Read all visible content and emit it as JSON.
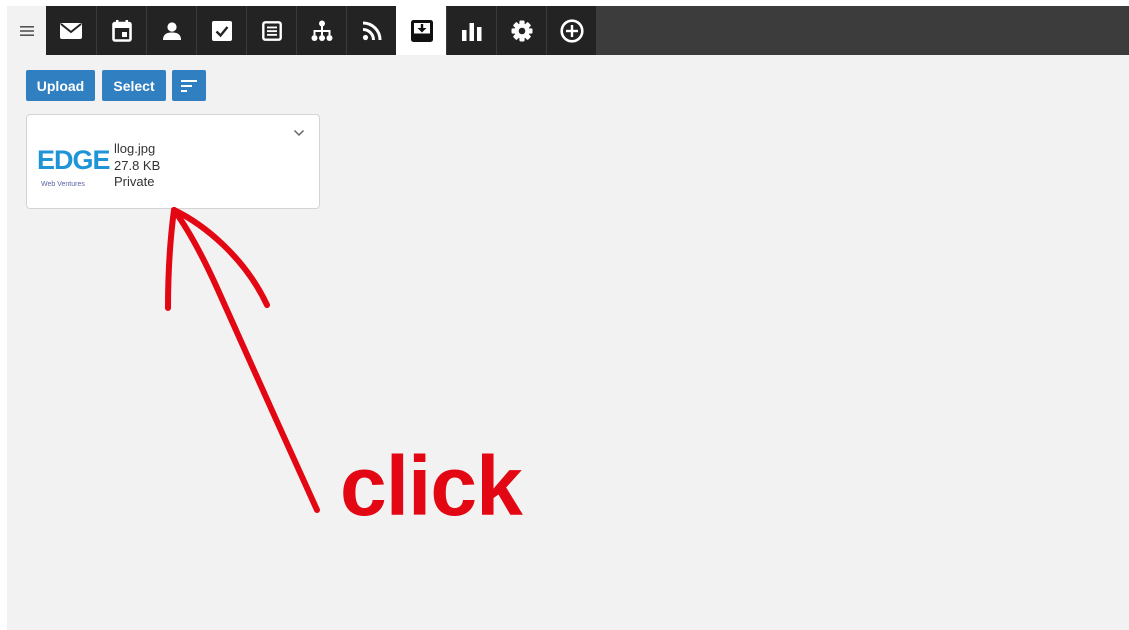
{
  "toolbar": {
    "tabs": [
      {
        "icon": "mail-icon",
        "active": false
      },
      {
        "icon": "calendar-icon",
        "active": false
      },
      {
        "icon": "person-icon",
        "active": false
      },
      {
        "icon": "checkbox-icon",
        "active": false
      },
      {
        "icon": "document-icon",
        "active": false
      },
      {
        "icon": "sitemap-icon",
        "active": false
      },
      {
        "icon": "rss-icon",
        "active": false
      },
      {
        "icon": "inbox-download-icon",
        "active": true
      },
      {
        "icon": "bar-chart-icon",
        "active": false
      },
      {
        "icon": "gear-icon",
        "active": false
      },
      {
        "icon": "plus-circle-icon",
        "active": false
      }
    ]
  },
  "actions": {
    "upload_label": "Upload",
    "select_label": "Select",
    "sort_icon": "sort-icon"
  },
  "file": {
    "thumbnail_logo": "EDGE",
    "thumbnail_tagline": "Web Ventures",
    "name": "llog.jpg",
    "size": "27.8 KB",
    "visibility": "Private"
  },
  "annotation": {
    "text": "click"
  },
  "colors": {
    "toolbar_bg": "#232323",
    "accent": "#2f7fc1",
    "annotation": "#e30613",
    "logo": "#1f95d8"
  }
}
